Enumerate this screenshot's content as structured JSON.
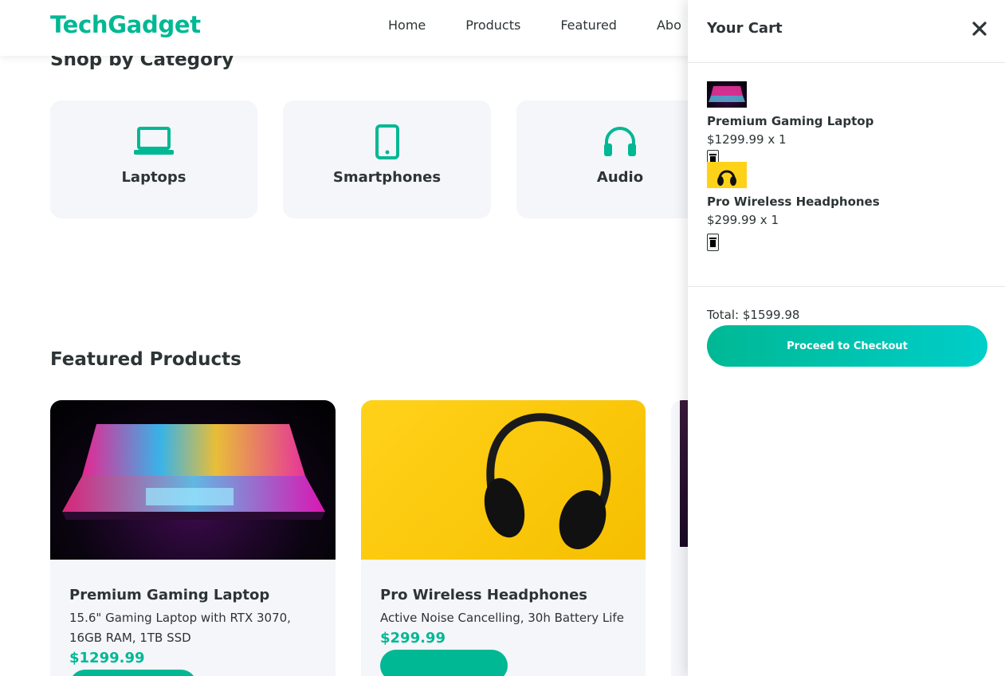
{
  "header": {
    "logo": "TechGadget",
    "nav": [
      "Home",
      "Products",
      "Featured",
      "Abo"
    ]
  },
  "categories": {
    "title": "Shop by Category",
    "items": [
      {
        "label": "Laptops",
        "icon": "laptop-icon"
      },
      {
        "label": "Smartphones",
        "icon": "smartphone-icon"
      },
      {
        "label": "Audio",
        "icon": "headphones-icon"
      }
    ]
  },
  "featured": {
    "title": "Featured Products",
    "products": [
      {
        "name": "Premium Gaming Laptop",
        "desc": "15.6\" Gaming Laptop with RTX 3070, 16GB RAM, 1TB SSD",
        "price": "$1299.99"
      },
      {
        "name": "Pro Wireless Headphones",
        "desc": "Active Noise Cancelling, 30h Battery Life",
        "price": "$299.99"
      }
    ]
  },
  "cart": {
    "title": "Your Cart",
    "items": [
      {
        "name": "Premium Gaming Laptop",
        "qty": "$1299.99 x 1"
      },
      {
        "name": "Pro Wireless Headphones",
        "qty": "$299.99 x 1"
      }
    ],
    "total": "Total: $1599.98",
    "checkout": "Proceed to Checkout"
  },
  "colors": {
    "accent": "#00b894",
    "accent2": "#00cec9",
    "text": "#2d3436",
    "card": "#f5f6fa"
  }
}
